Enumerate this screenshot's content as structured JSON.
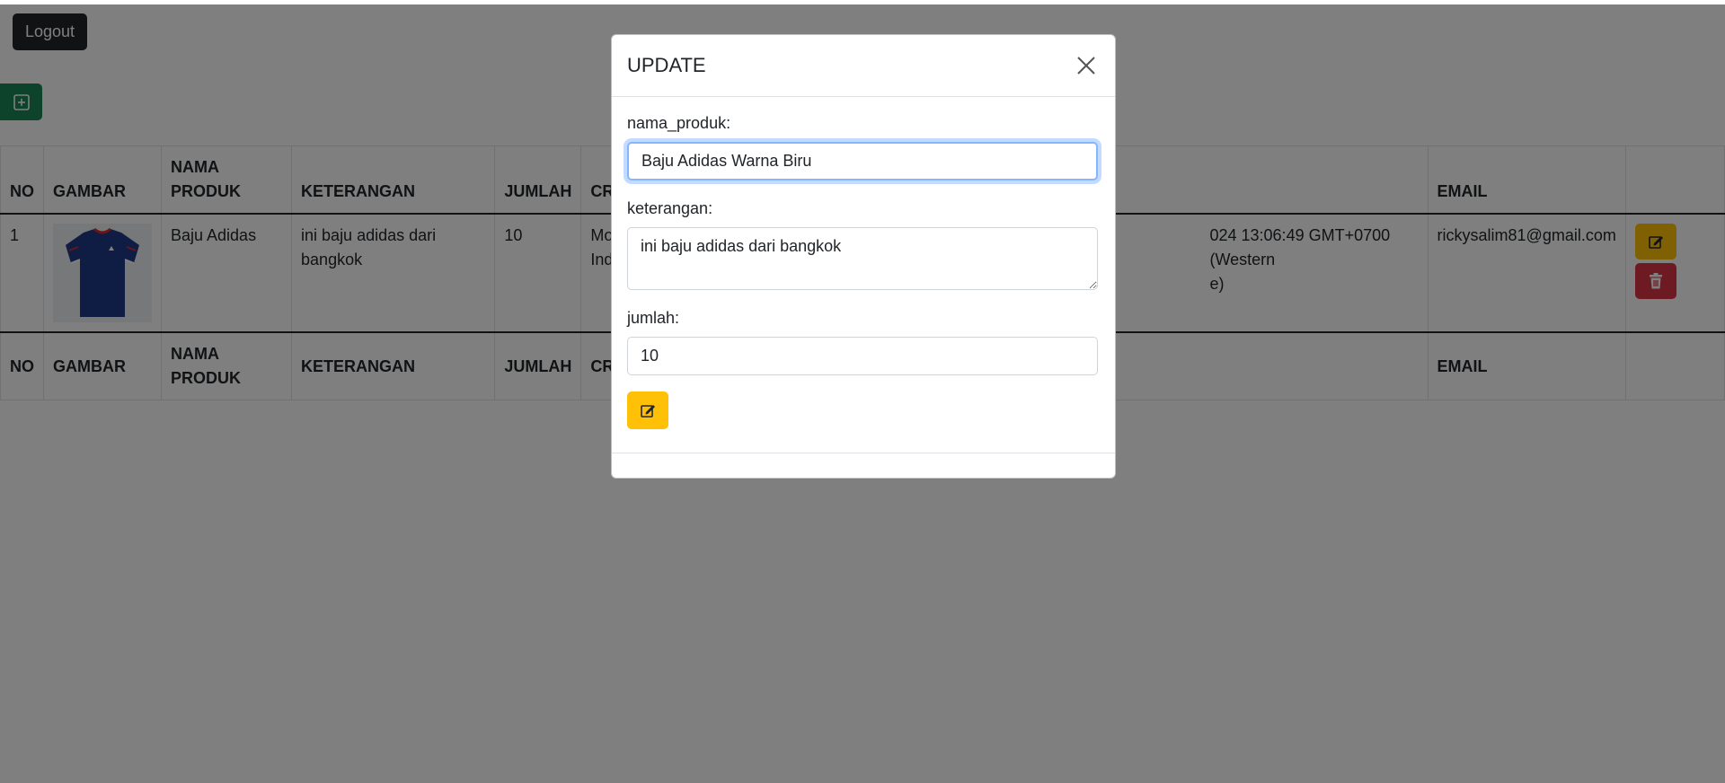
{
  "header": {
    "logout_label": "Logout"
  },
  "toolbar": {
    "add_icon": "plus-square-icon"
  },
  "table": {
    "columns": [
      "NO",
      "GAMBAR",
      "NAMA PRODUK",
      "KETERANGAN",
      "JUMLAH",
      "CR",
      "",
      "EMAIL",
      ""
    ],
    "rows": [
      {
        "no": "1",
        "nama_produk": "Baju Adidas",
        "keterangan": "ini baju adidas dari bangkok",
        "jumlah": "10",
        "created_partial": "Mo Ind",
        "created_partial_line1": "Mo",
        "created_partial_line2": "Ind",
        "updated_partial_line1": "024 13:06:49 GMT+0700 (Western",
        "updated_partial_line2": "e)",
        "email": "rickysalim81@gmail.com"
      }
    ]
  },
  "modal": {
    "title": "UPDATE",
    "nama_label": "nama_produk:",
    "nama_value": "Baju Adidas Warna Biru",
    "keterangan_label": "keterangan:",
    "keterangan_value": "ini baju adidas dari bangkok",
    "jumlah_label": "jumlah:",
    "jumlah_value": "10"
  },
  "colors": {
    "success": "#198754",
    "warning": "#ffc107",
    "danger": "#dc3545",
    "dark": "#212529",
    "focus": "#86b7fe"
  }
}
